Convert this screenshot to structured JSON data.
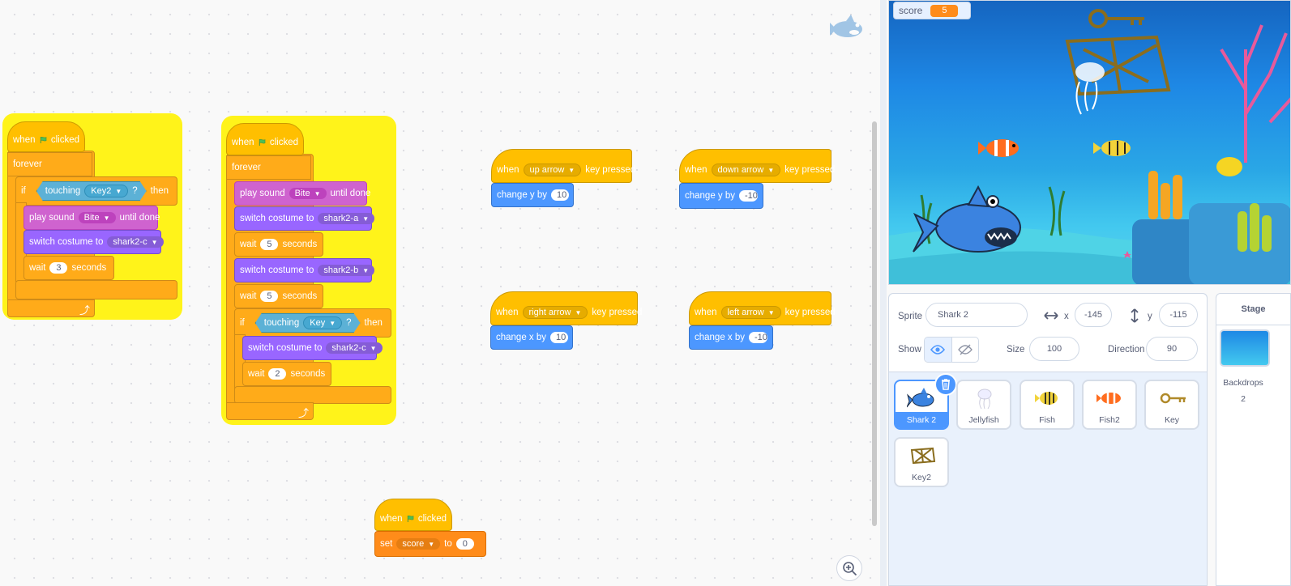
{
  "scripts": {
    "s1": {
      "when": "when",
      "clicked": "clicked",
      "forever": "forever",
      "if": "if",
      "touching": "touching",
      "touching_target": "Key2",
      "q": "?",
      "then": "then",
      "play_sound": "play sound",
      "sound": "Bite",
      "until_done": "until done",
      "switch_costume": "switch costume to",
      "costume": "shark2-c",
      "wait": "wait",
      "wait_val": "3",
      "seconds": "seconds"
    },
    "s2": {
      "when": "when",
      "clicked": "clicked",
      "forever": "forever",
      "play_sound": "play sound",
      "sound": "Bite",
      "until_done": "until done",
      "switch_costume_1": "switch costume to",
      "costume_1": "shark2-a",
      "wait_1": "wait",
      "wait_val_1": "5",
      "seconds_1": "seconds",
      "switch_costume_2": "switch costume to",
      "costume_2": "shark2-b",
      "wait_2": "wait",
      "wait_val_2": "5",
      "seconds_2": "seconds",
      "if": "if",
      "touching": "touching",
      "touching_target": "Key",
      "q": "?",
      "then": "then",
      "switch_costume_3": "switch costume to",
      "costume_3": "shark2-c",
      "wait_3": "wait",
      "wait_val_3": "2",
      "seconds_3": "seconds"
    },
    "s3": {
      "when": "when",
      "key": "up arrow",
      "key_pressed": "key pressed",
      "change": "change y by",
      "val": "10"
    },
    "s4": {
      "when": "when",
      "key": "down arrow",
      "key_pressed": "key pressed",
      "change": "change y by",
      "val": "-10"
    },
    "s5": {
      "when": "when",
      "key": "right arrow",
      "key_pressed": "key pressed",
      "change": "change x by",
      "val": "10"
    },
    "s6": {
      "when": "when",
      "key": "left arrow",
      "key_pressed": "key pressed",
      "change": "change x by",
      "val": "-10"
    },
    "s7": {
      "when": "when",
      "clicked": "clicked",
      "set": "set",
      "var": "score",
      "to": "to",
      "val": "0"
    }
  },
  "stage": {
    "monitor_label": "score",
    "monitor_value": "5"
  },
  "sprite_info": {
    "sprite_label": "Sprite",
    "sprite_name": "Shark 2",
    "x_label": "x",
    "x_value": "-145",
    "y_label": "y",
    "y_value": "-115",
    "show_label": "Show",
    "size_label": "Size",
    "size_value": "100",
    "direction_label": "Direction",
    "direction_value": "90"
  },
  "sprites": [
    {
      "name": "Shark 2",
      "selected": true
    },
    {
      "name": "Jellyfish"
    },
    {
      "name": "Fish"
    },
    {
      "name": "Fish2"
    },
    {
      "name": "Key"
    },
    {
      "name": "Key2"
    }
  ],
  "stage_panel": {
    "title": "Stage",
    "backdrops_label": "Backdrops",
    "backdrops_count": "2"
  },
  "colors": {
    "events": "#ffbf00",
    "control": "#ffab19",
    "motion": "#4c97ff",
    "looks": "#9966ff",
    "sound": "#cf63cf",
    "sensing": "#5cb1d6",
    "variables": "#ff8c1a",
    "glow": "#fff31a"
  }
}
